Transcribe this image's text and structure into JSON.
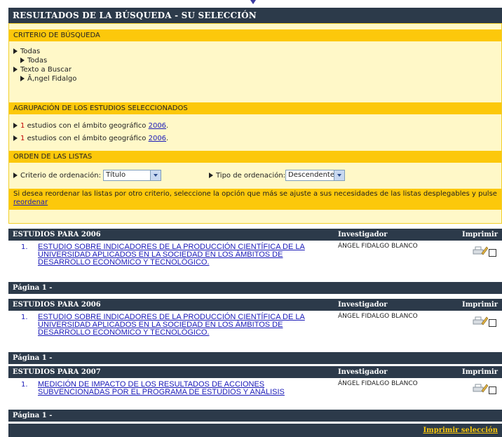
{
  "header": {
    "title": "RESULTADOS DE LA BÚSQUEDA - SU SELECCIÓN"
  },
  "criterio": {
    "heading": "CRITERIO DE BÚSQUEDA",
    "items": [
      "Todas",
      "Todas",
      "Texto a Buscar",
      "Ã‚ngel Fidalgo"
    ]
  },
  "agrupacion": {
    "heading": "AGRUPACIÓN DE LOS ESTUDIOS SELECCIONADOS",
    "rows": [
      {
        "count": "1",
        "text": "estudios con el ámbito geográfico",
        "link": "2006",
        "suffix": "."
      },
      {
        "count": "1",
        "text": "estudios con el ámbito geográfico",
        "link": "2006",
        "suffix": "."
      }
    ]
  },
  "orden": {
    "heading": "ORDEN DE LAS LISTAS",
    "criterio_label": "Criterio de ordenación:",
    "criterio_value": "Título",
    "tipo_label": "Tipo de ordenación:",
    "tipo_value": "Descendente",
    "note": "Si desea reordenar las listas por otro criterio, seleccione la opción que más se ajuste a sus necesidades de las listas desplegables y pulse",
    "note_link": "reordenar"
  },
  "groups": [
    {
      "header": "ESTUDIOS PARA 2006",
      "col_inv": "Investigador",
      "col_print": "Imprimir",
      "num": "1.",
      "title": "ESTUDIO SOBRE INDICADORES DE LA PRODUCCIÓN CIENTÍFICA DE LA UNIVERSIDAD APLICADOS EN LA SOCIEDAD EN LOS ÁMBITOS DE DESARROLLO ECONÓMICO Y TECNOLÓGICO.",
      "investigador": "ÁNGEL FIDALGO BLANCO",
      "page": "Página 1 -"
    },
    {
      "header": "ESTUDIOS PARA 2006",
      "col_inv": "Investigador",
      "col_print": "Imprimir",
      "num": "1.",
      "title": "ESTUDIO SOBRE INDICADORES DE LA PRODUCCIÓN CIENTÍFICA DE LA UNIVERSIDAD APLICADOS EN LA SOCIEDAD EN LOS ÁMBITOS DE DESARROLLO ECONÓMICO Y TECNOLÓGICO.",
      "investigador": "ÁNGEL FIDALGO BLANCO",
      "page": "Página 1 -"
    },
    {
      "header": "ESTUDIOS PARA 2007",
      "col_inv": "Investigador",
      "col_print": "Imprimir",
      "num": "1.",
      "title": "MEDICIÓN DE IMPACTO DE LOS RESULTADOS DE ACCIONES SUBVENCIONADAS POR EL PROGRAMA DE ESTUDIOS Y ANÁLISIS",
      "investigador": "ÁNGEL FIDALGO BLANCO",
      "page": "Página 1 -"
    }
  ],
  "footer": {
    "print_selection": "Imprimir selección"
  },
  "icons": {
    "print": "printer-pen-icon",
    "bullet": "triangle-bullet-icon",
    "checkbox": "checkbox-icon"
  },
  "colors": {
    "dark": "#2c3a4a",
    "yellow": "#fcc80b",
    "pale_yellow": "#fff8c8",
    "link": "#1a1ab8"
  }
}
